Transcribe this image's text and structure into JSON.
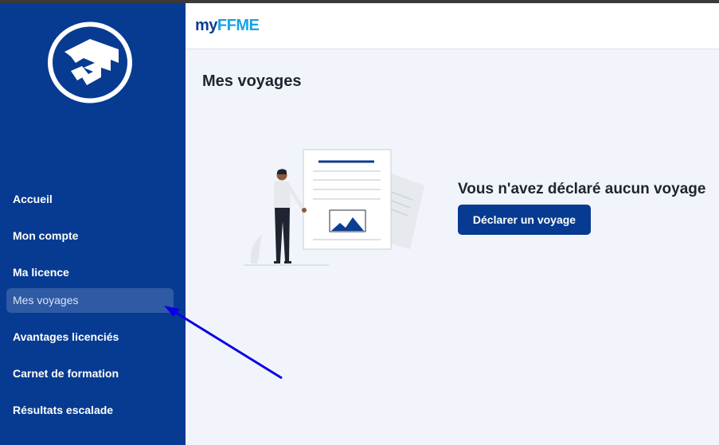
{
  "app": {
    "brand_prefix": "my",
    "brand_suffix": "FFME"
  },
  "sidebar": {
    "items": [
      {
        "label": "Accueil",
        "active": false
      },
      {
        "label": "Mon compte",
        "active": false
      },
      {
        "label": "Ma licence",
        "active": false
      },
      {
        "label": "Mes voyages",
        "active": true
      },
      {
        "label": "Avantages licenciés",
        "active": false
      },
      {
        "label": "Carnet de formation",
        "active": false
      },
      {
        "label": "Résultats escalade",
        "active": false
      }
    ]
  },
  "main": {
    "title": "Mes voyages",
    "empty_message": "Vous n'avez déclaré aucun voyage",
    "cta_label": "Déclarer un voyage"
  },
  "colors": {
    "sidebar_bg": "#073b91",
    "brand_blue": "#0b3d91",
    "brand_cyan": "#17a3e6",
    "annotation_arrow": "#0a00e6"
  },
  "icons": [
    "ffme-logo-icon",
    "document-illustration",
    "annotation-arrow"
  ]
}
